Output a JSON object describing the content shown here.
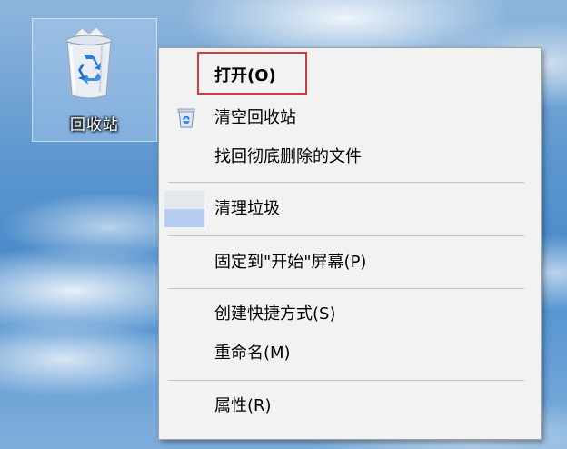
{
  "desktop": {
    "recycle_bin": {
      "label": "回收站",
      "icon": "recycle-bin-icon"
    }
  },
  "context_menu": {
    "items": [
      {
        "label": "打开(O)",
        "bold": true,
        "highlighted": true
      },
      {
        "label": "清空回收站",
        "icon": "recycle-bin-small-icon"
      },
      {
        "label": "找回彻底删除的文件"
      },
      {
        "label": "清理垃圾",
        "icon": "cleanup-icon"
      },
      {
        "label": "固定到\"开始\"屏幕(P)"
      },
      {
        "label": "创建快捷方式(S)"
      },
      {
        "label": "重命名(M)"
      },
      {
        "label": "属性(R)"
      }
    ]
  },
  "colors": {
    "highlight_border": "#d23c3c",
    "menu_background": "#f2f2f2",
    "desktop_sky": "#4c8ccb"
  }
}
